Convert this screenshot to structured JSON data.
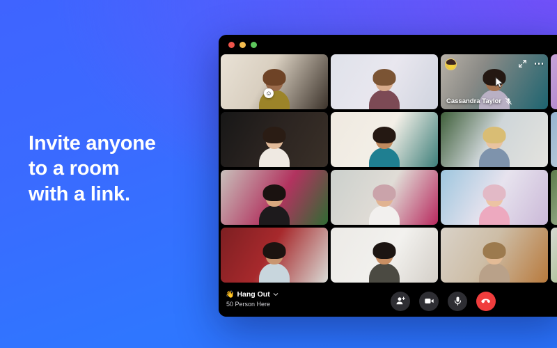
{
  "promo": {
    "headline": "Invite anyone\nto a room\nwith a link."
  },
  "colors": {
    "bg_blue": "#3f64ff",
    "bg_purple": "#7150f8",
    "window_bg": "#000000",
    "hangup_red": "#f03d3d",
    "control_grey": "#2e2e33",
    "light_red": "#ef554b",
    "light_yellow": "#f4bd4f",
    "light_green": "#5dc75c"
  },
  "window": {
    "traffic_lights": [
      {
        "name": "close-button",
        "color": "#ef554b"
      },
      {
        "name": "minimize-button",
        "color": "#f4bd4f"
      },
      {
        "name": "maximize-button",
        "color": "#5dc75c"
      }
    ]
  },
  "grid": {
    "tiles": [
      {
        "id": 1,
        "name": "",
        "muted": false,
        "reaction": "☺",
        "bg": "linear-gradient(120deg,#e9e2d6 0%,#d9cfc0 42%,#3c332b 100%)",
        "skin": "#9a6a4a",
        "hair": "#6e4326",
        "shirt": "#9c8429"
      },
      {
        "id": 2,
        "name": "",
        "muted": false,
        "reaction": "",
        "bg": "linear-gradient(120deg,#dfe2ea 0%,#e9e7ef 50%,#cfd3de 100%)",
        "skin": "#d8ab8b",
        "hair": "#7b5434",
        "shirt": "#7c4a55"
      },
      {
        "id": 3,
        "name": "Cassandra Taylor",
        "muted": true,
        "reaction": "",
        "bg": "linear-gradient(120deg,#b9b2a8 0%,#8a8a86 35%,#1d6470 100%)",
        "skin": "#a3724f",
        "hair": "#241812",
        "shirt": "#b9b0c4"
      },
      {
        "id": 4,
        "name": "",
        "muted": false,
        "reaction": "",
        "bg": "linear-gradient(120deg,#c8a3d8 0%,#a06fc4 60%,#ead9f2 100%)",
        "skin": "#d7a886",
        "hair": "#2c1d18",
        "shirt": "#efe6f4"
      },
      {
        "id": 5,
        "name": "",
        "muted": false,
        "reaction": "",
        "bg": "linear-gradient(120deg,#171717 0%,#2a2320 45%,#3a3028 100%)",
        "skin": "#e2bb9a",
        "hair": "#2a1c14",
        "shirt": "#efe9e2"
      },
      {
        "id": 6,
        "name": "",
        "muted": false,
        "reaction": "",
        "bg": "linear-gradient(120deg,#efe9e0 0%,#f3efe7 50%,#3d7f7a 100%)",
        "skin": "#c08a5e",
        "hair": "#241812",
        "shirt": "#1f7f91"
      },
      {
        "id": 7,
        "name": "",
        "muted": false,
        "reaction": "",
        "bg": "linear-gradient(120deg,#3f5f3a 0%,#cfd6d9 48%,#e4e3de 100%)",
        "skin": "#e8c3a0",
        "hair": "#d9bd74",
        "shirt": "#7e93ac"
      },
      {
        "id": 8,
        "name": "",
        "muted": false,
        "reaction": "",
        "bg": "linear-gradient(120deg,#95b3cf 0%,#cdd6de 50%,#5e6a72 100%)",
        "skin": "#dfb18e",
        "hair": "#2b1d16",
        "shirt": "#7c5f8e"
      },
      {
        "id": 9,
        "name": "",
        "muted": false,
        "reaction": "",
        "bg": "linear-gradient(120deg,#c8c0bb 0%,#b2335f 55%,#2f6b33 100%)",
        "skin": "#d9a87f",
        "hair": "#1a1210",
        "shirt": "#1d1a1c"
      },
      {
        "id": 10,
        "name": "",
        "muted": false,
        "reaction": "",
        "bg": "linear-gradient(120deg,#cbd0cc 0%,#e0dcd6 50%,#b8295e 100%)",
        "skin": "#e1b391",
        "hair": "#caa3aa",
        "shirt": "#f2f0ee"
      },
      {
        "id": 11,
        "name": "",
        "muted": false,
        "reaction": "",
        "bg": "linear-gradient(120deg,#9ec6de 0%,#e7e3ee 50%,#cbb9d8 100%)",
        "skin": "#ecc3a3",
        "hair": "#e2b9c6",
        "shirt": "#eda9bf"
      },
      {
        "id": 12,
        "name": "",
        "muted": false,
        "reaction": "",
        "bg": "linear-gradient(120deg,#5d7a4a 0%,#b7c7ab 50%,#e5e7df 100%)",
        "skin": "#e3b48f",
        "hair": "#3a2a20",
        "shirt": "#d8d2c8"
      },
      {
        "id": 13,
        "name": "",
        "muted": false,
        "reaction": "",
        "bg": "linear-gradient(120deg,#7d1f22 0%,#a7292c 45%,#d9dbd6 100%)",
        "skin": "#c99670",
        "hair": "#1c1310",
        "shirt": "#c8d6dd"
      },
      {
        "id": 14,
        "name": "",
        "muted": false,
        "reaction": "",
        "bg": "linear-gradient(120deg,#eceae6 0%,#f2f1ee 55%,#d4cfc8 100%)",
        "skin": "#c98f63",
        "hair": "#1c1512",
        "shirt": "#4b4a42"
      },
      {
        "id": 15,
        "name": "",
        "muted": false,
        "reaction": "",
        "bg": "linear-gradient(120deg,#d9d2c8 0%,#cdbda6 45%,#b87a3d 100%)",
        "skin": "#e3bb96",
        "hair": "#9c7a4e",
        "shirt": "#b9a189"
      },
      {
        "id": 16,
        "name": "",
        "muted": false,
        "reaction": "",
        "bg": "linear-gradient(120deg,#d7d9d2 0%,#8fae6e 55%,#54763f 100%)",
        "skin": "#dcae8a",
        "hair": "#3c2c20",
        "shirt": "#dfe0dc"
      }
    ],
    "focused_tile_id": 3
  },
  "bottom_bar": {
    "room_emoji": "👋",
    "room_name": "Hang Out",
    "participants_text": "50 Person Here",
    "controls": [
      {
        "name": "add-person-button",
        "label": "Add person"
      },
      {
        "name": "video-camera-button",
        "label": "Camera"
      },
      {
        "name": "microphone-button",
        "label": "Microphone"
      },
      {
        "name": "end-call-button",
        "label": "Leave"
      }
    ]
  }
}
